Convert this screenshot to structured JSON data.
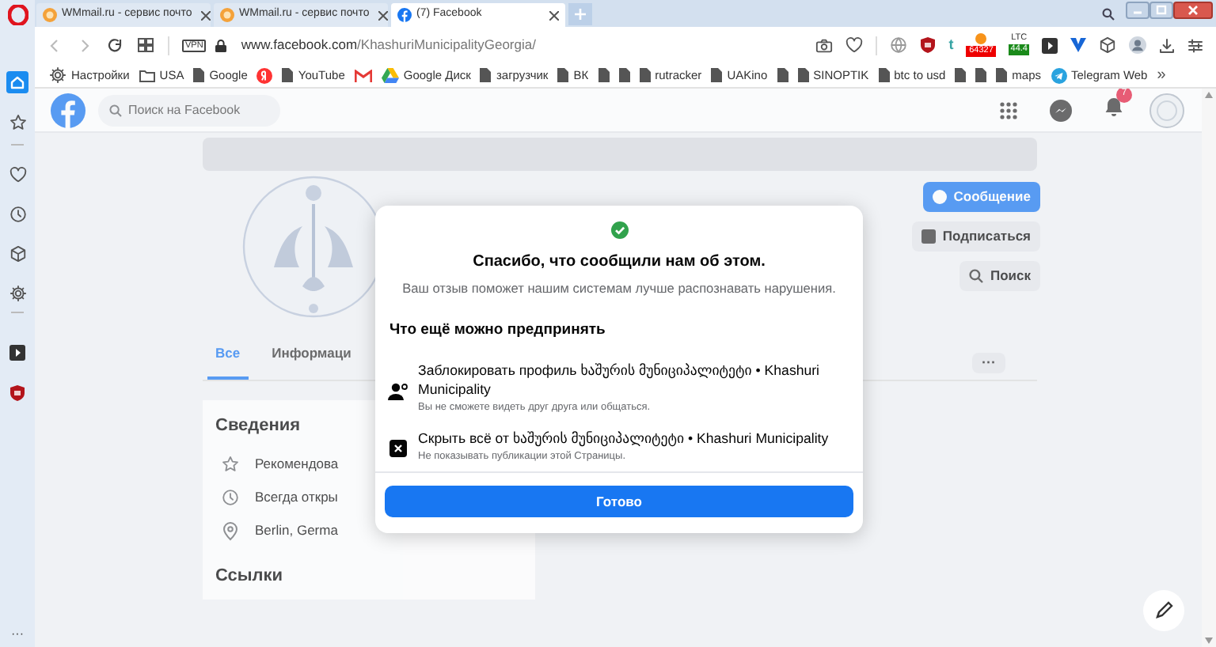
{
  "browser": {
    "tabs": [
      {
        "kind": "wmmail",
        "title": "WMmail.ru - сервис почто",
        "selected": false
      },
      {
        "kind": "wmmail",
        "title": "WMmail.ru - сервис почто",
        "selected": false
      },
      {
        "kind": "facebook",
        "title": "(7) Facebook",
        "selected": true
      }
    ],
    "vpn_label": "VPN",
    "url_host": "www.facebook.com",
    "url_path": "/KhashuriMunicipalityGeorgia/",
    "extensions": [
      {
        "kind": "camera"
      },
      {
        "kind": "heart"
      },
      {
        "kind": "globe"
      },
      {
        "kind": "shield"
      },
      {
        "kind": "tumblr",
        "label": "t"
      },
      {
        "kind": "btc",
        "label": "64327"
      },
      {
        "kind": "ltc",
        "label": "LTC",
        "value": "44.4"
      },
      {
        "kind": "player"
      },
      {
        "kind": "vee"
      },
      {
        "kind": "cube"
      },
      {
        "kind": "avatar"
      },
      {
        "kind": "download"
      },
      {
        "kind": "sliders"
      }
    ],
    "bookmarks": [
      {
        "kind": "gear",
        "label": "Настройки"
      },
      {
        "kind": "folder",
        "label": "USA"
      },
      {
        "kind": "page",
        "label": "Google"
      },
      {
        "kind": "yandex"
      },
      {
        "kind": "page",
        "label": "YouTube"
      },
      {
        "kind": "gmail"
      },
      {
        "kind": "drive",
        "label": "Google Диск"
      },
      {
        "kind": "page",
        "label": "загрузчик"
      },
      {
        "kind": "page",
        "label": "ВК"
      },
      {
        "kind": "page"
      },
      {
        "kind": "page"
      },
      {
        "kind": "page",
        "label": "rutracker"
      },
      {
        "kind": "page",
        "label": "UAKino"
      },
      {
        "kind": "page"
      },
      {
        "kind": "page",
        "label": "SINOPTIK"
      },
      {
        "kind": "page",
        "label": "btc to usd"
      },
      {
        "kind": "page"
      },
      {
        "kind": "page"
      },
      {
        "kind": "page",
        "label": "maps"
      },
      {
        "kind": "telegram",
        "label": "Telegram Web"
      }
    ],
    "bookmarks_more": "»",
    "sidebar": [
      {
        "kind": "home",
        "selected": true
      },
      {
        "kind": "star",
        "selected": false
      },
      {
        "kind": "heart",
        "selected": false
      },
      {
        "kind": "clock",
        "selected": false
      },
      {
        "kind": "cube",
        "selected": false
      },
      {
        "kind": "gear",
        "selected": false
      },
      {
        "kind": "player",
        "selected": false
      },
      {
        "kind": "shield",
        "selected": false
      }
    ],
    "sidebar_more": "···"
  },
  "page": {
    "search_placeholder": "Поиск на Facebook",
    "notification_count": "7",
    "buttons": [
      "Сообщение",
      "Подписаться",
      "Поиск"
    ],
    "tabs": [
      {
        "label": "Все",
        "selected": true
      },
      {
        "label": "Информаци",
        "selected": false
      }
    ],
    "more_button": "···",
    "about_title": "Сведения",
    "about_rows": [
      {
        "kind": "star",
        "text": "Рекомендова"
      },
      {
        "kind": "clock",
        "text": "Всегда откры"
      },
      {
        "kind": "pin",
        "text": "Berlin, Germa"
      }
    ],
    "links_title": "Ссылки"
  },
  "dialog": {
    "title": "Спасибо, что сообщили нам об этом.",
    "subtitle": "Ваш отзыв поможет нашим системам лучше распознавать нарушения.",
    "section": "Что ещё можно предпринять",
    "options": [
      {
        "kind": "block",
        "title": "Заблокировать профиль ხაშურის მუნიციპალიტეტი • Khashuri Municipality",
        "note": "Вы не сможете видеть друг друга или общаться."
      },
      {
        "kind": "hide",
        "title": "Скрыть всё от ხაშურის მუნიციპალიტეტი • Khashuri Municipality",
        "note": "Не показывать публикации этой Страницы."
      }
    ],
    "button": "Готово"
  }
}
